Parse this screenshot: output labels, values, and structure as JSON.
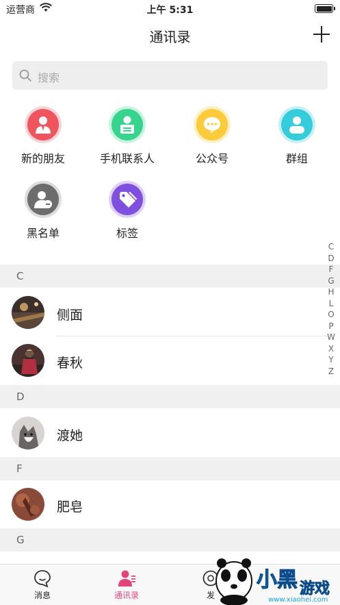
{
  "status_bar": {
    "carrier": "运营商",
    "time": "上午 5:31"
  },
  "nav": {
    "title": "通讯录",
    "add_icon": "plus-icon"
  },
  "search": {
    "placeholder": "搜索"
  },
  "functions": [
    {
      "label": "新的朋友",
      "icon": "new-friend-icon",
      "color": "#f0555f"
    },
    {
      "label": "手机联系人",
      "icon": "phone-contacts-icon",
      "color": "#37d48f"
    },
    {
      "label": "公众号",
      "icon": "official-account-icon",
      "color": "#fccb3c"
    },
    {
      "label": "群组",
      "icon": "group-icon",
      "color": "#35ccdc"
    },
    {
      "label": "黑名单",
      "icon": "blacklist-icon",
      "color": "#6d6d6d"
    },
    {
      "label": "标签",
      "icon": "tag-icon",
      "color": "#7f4fe0"
    }
  ],
  "sections": [
    {
      "letter": "C",
      "contacts": [
        "侧面",
        "春秋"
      ]
    },
    {
      "letter": "D",
      "contacts": [
        "渡她"
      ]
    },
    {
      "letter": "F",
      "contacts": [
        "肥皂"
      ]
    },
    {
      "letter": "G",
      "contacts": []
    }
  ],
  "index_letters": [
    "C",
    "D",
    "F",
    "G",
    "H",
    "L",
    "O",
    "P",
    "W",
    "X",
    "Y",
    "Z"
  ],
  "tabs": [
    {
      "label": "消息",
      "icon": "message-icon",
      "active": false
    },
    {
      "label": "通讯录",
      "icon": "contacts-icon",
      "active": true
    },
    {
      "label": "发",
      "icon": "discover-icon",
      "active": false
    }
  ],
  "colors": {
    "accent": "#e2457a",
    "section_bg": "#f0f0f0",
    "search_bg": "#eeeeee"
  },
  "watermark": {
    "text": "小黑游戏",
    "url": "www.xiaohei.com"
  }
}
